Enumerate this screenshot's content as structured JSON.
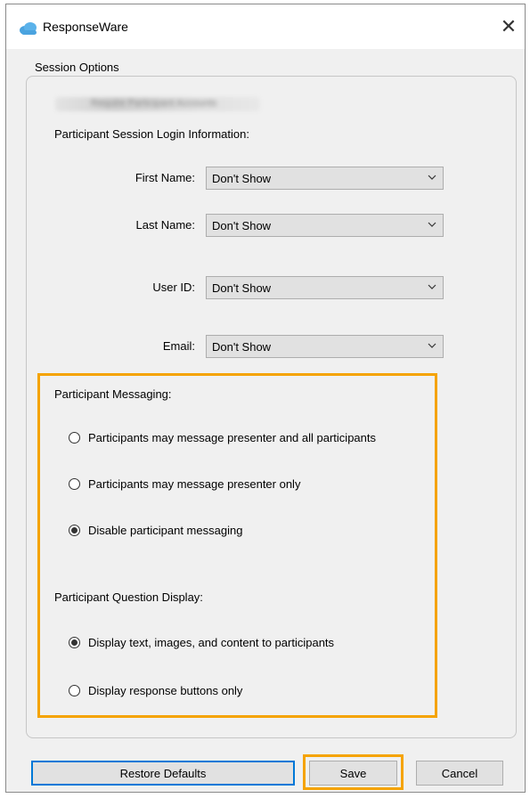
{
  "window": {
    "title": "ResponseWare",
    "close_glyph": "✕",
    "app_icon": "cloud-icon",
    "accent_color": "#f5a300"
  },
  "session_options_label": "Session Options",
  "blurred_option_label": "Require Participant Accounts",
  "login_info": {
    "heading": "Participant Session Login Information:",
    "fields": [
      {
        "label": "First Name:",
        "value": "Don't Show"
      },
      {
        "label": "Last Name:",
        "value": "Don't Show"
      },
      {
        "label": "User ID:",
        "value": "Don't Show"
      },
      {
        "label": "Email:",
        "value": "Don't Show"
      }
    ]
  },
  "messaging": {
    "heading": "Participant Messaging:",
    "options": [
      {
        "label": "Participants may message presenter and all participants",
        "checked": false
      },
      {
        "label": "Participants may message presenter only",
        "checked": false
      },
      {
        "label": "Disable participant messaging",
        "checked": true
      }
    ]
  },
  "question_display": {
    "heading": "Participant Question Display:",
    "options": [
      {
        "label": "Display text, images, and content to participants",
        "checked": true
      },
      {
        "label": "Display response buttons only",
        "checked": false
      }
    ]
  },
  "buttons": {
    "restore_defaults": "Restore Defaults",
    "save": "Save",
    "cancel": "Cancel"
  }
}
